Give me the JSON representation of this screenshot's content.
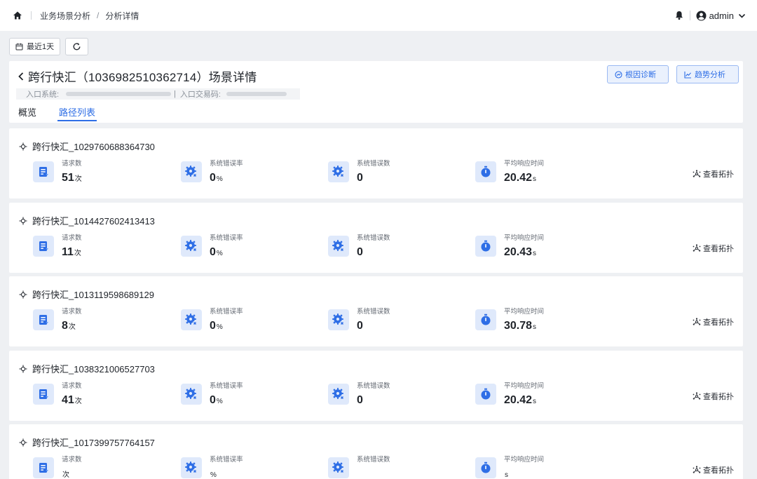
{
  "header": {
    "breadcrumb": [
      "业务场景分析",
      "分析详情"
    ],
    "breadcrumb_separator": "/",
    "username": "admin"
  },
  "toolbar": {
    "time_range_label": "最近1天"
  },
  "detail": {
    "title": "跨行快汇（1036982510362714）场景详情",
    "entry_system_label": "入口系统:",
    "entry_code_label": "入口交易码:",
    "meta_divider": "|",
    "tabs": [
      {
        "label": "概览",
        "active": false
      },
      {
        "label": "路径列表",
        "active": true
      }
    ],
    "actions": {
      "diagnose_label": "根因诊断",
      "trend_label": "趋势分析"
    }
  },
  "metric_labels": {
    "requests": "请求数",
    "error_rate": "系统错误率",
    "error_count": "系统错误数",
    "avg_response": "平均响应时间"
  },
  "units": {
    "requests": "次",
    "error_rate": "%",
    "avg_response": "s"
  },
  "topology_label": "查看拓扑",
  "paths": [
    {
      "name": "跨行快汇_1029760688364730",
      "requests": "51",
      "error_rate": "0",
      "error_count": "0",
      "avg_response": "20.42"
    },
    {
      "name": "跨行快汇_1014427602413413",
      "requests": "11",
      "error_rate": "0",
      "error_count": "0",
      "avg_response": "20.43"
    },
    {
      "name": "跨行快汇_1013119598689129",
      "requests": "8",
      "error_rate": "0",
      "error_count": "0",
      "avg_response": "30.78"
    },
    {
      "name": "跨行快汇_1038321006527703",
      "requests": "41",
      "error_rate": "0",
      "error_count": "0",
      "avg_response": "20.42"
    },
    {
      "name": "跨行快汇_1017399757764157",
      "requests": "",
      "error_rate": "",
      "error_count": "",
      "avg_response": ""
    }
  ],
  "colors": {
    "accent": "#2e6ee6",
    "icon_bg": "#dfe9fb",
    "page_bg": "#eef0f3"
  },
  "icons": {
    "home": "home-icon",
    "bell": "bell-icon",
    "user": "user-circle-icon",
    "calendar": "calendar-icon",
    "refresh": "refresh-icon",
    "back": "chevron-left-icon",
    "diagnose": "diagnose-icon",
    "trend": "trend-chart-icon",
    "route": "route-icon",
    "requests": "document-list-icon",
    "error": "gear-error-icon",
    "timer": "stopwatch-icon",
    "topology": "topology-icon"
  }
}
